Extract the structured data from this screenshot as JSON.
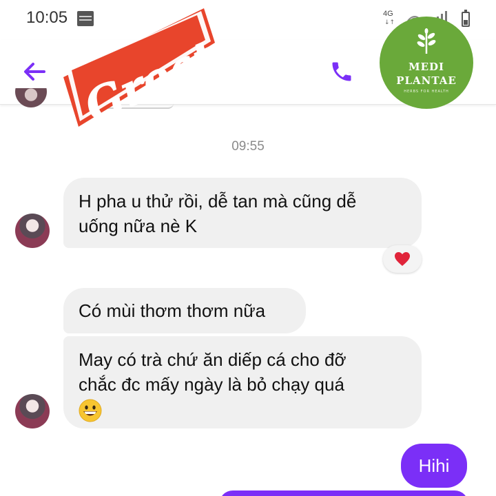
{
  "status_bar": {
    "time": "10:05",
    "network": "4G",
    "network_arrows": "↓↑"
  },
  "header": {
    "back_icon": "arrow-left-icon",
    "call_icon": "phone-icon",
    "accent_color": "#7b2ff7"
  },
  "sticker": {
    "text": "Great!",
    "color": "#e8452c"
  },
  "logo": {
    "line1": "MEDI",
    "line2": "PLANTAE",
    "tagline": "HERBS FOR HEALTH",
    "color": "#6aa93a"
  },
  "chat": {
    "timestamp": "09:55",
    "messages": [
      {
        "lines": [
          "H pha u thử rồi, dễ tan mà cũng dễ",
          "uống nữa nè K"
        ],
        "reaction": "heart"
      },
      {
        "lines": [
          "Có mùi thơm thơm nữa"
        ]
      },
      {
        "lines": [
          "May có trà chứ ăn diếp cá cho đỡ",
          "chắc đc mấy ngày là bỏ chạy quá"
        ],
        "emoji": "grinning-face"
      }
    ],
    "outgoing": [
      {
        "text": "Hihi"
      }
    ]
  }
}
